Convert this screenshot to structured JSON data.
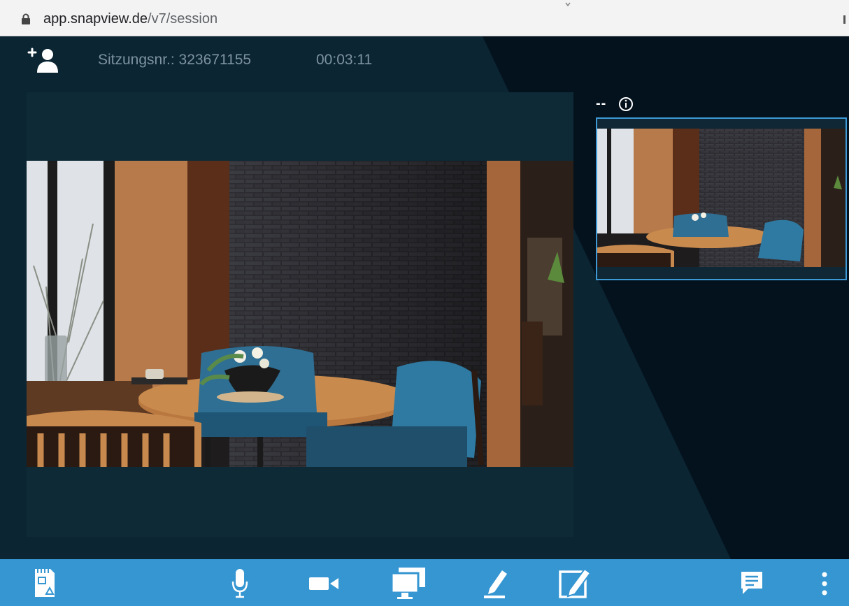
{
  "browser": {
    "url_host": "app.snapview.de",
    "url_path": "/v7/session"
  },
  "header": {
    "add_user_icon": "add-user-icon",
    "session_label": "Sitzungsnr.: 323671155",
    "timer": "00:03:11"
  },
  "remote": {
    "label": "--",
    "info_icon": "info-icon"
  },
  "toolbar": {
    "icons": [
      "snapshot-icon",
      "microphone-icon",
      "camera-icon",
      "screenshare-icon",
      "annotate-icon",
      "edit-icon",
      "chat-icon",
      "more-icon"
    ]
  },
  "colors": {
    "toolbar_bg": "#3596d2",
    "stage_bg": "#04121d",
    "panel_bg": "#0e2a37",
    "thumb_border": "#3d9ad6",
    "muted_text": "#7d93a1"
  }
}
